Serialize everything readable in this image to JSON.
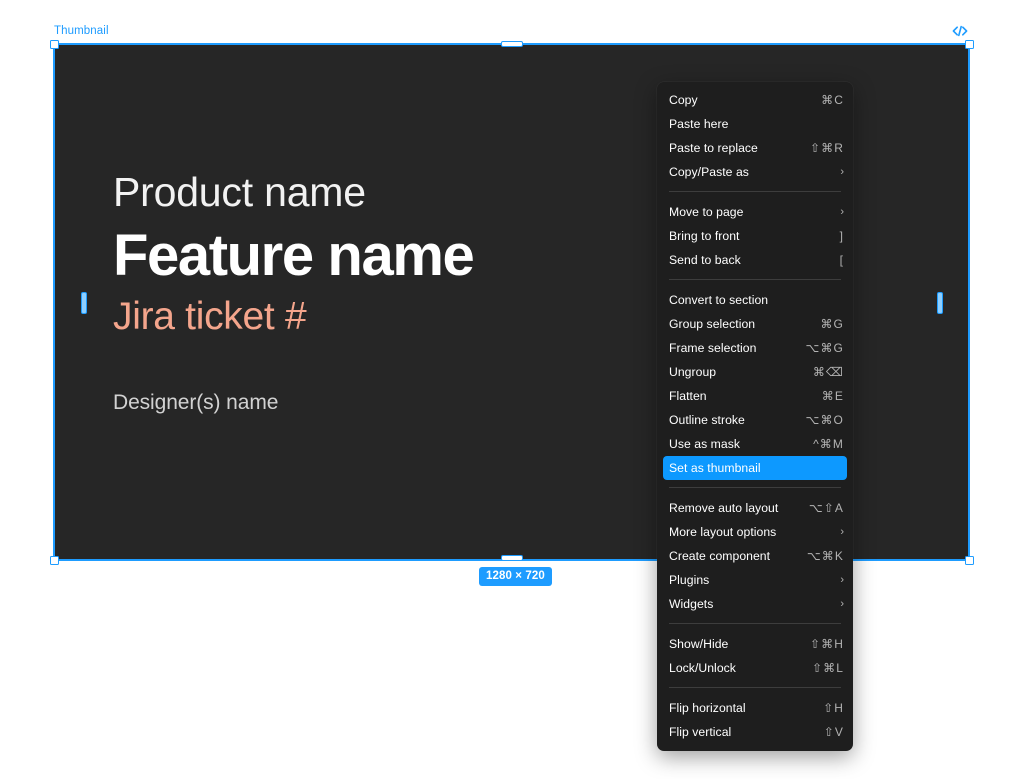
{
  "canvas": {
    "background_color": "#ffffff",
    "frame_label": "Thumbnail",
    "code_icon": "code-icon",
    "size_badge": "1280 × 720",
    "accent_color": "#1e9cff",
    "thumbnail": {
      "background_color": "#262626",
      "product_name": "Product name",
      "feature_name": "Feature name",
      "jira_ticket": "Jira ticket #",
      "jira_ticket_color": "#f4a58c",
      "designer_name": "Designer(s) name"
    }
  },
  "context_menu": {
    "highlight_color": "#0d99ff",
    "groups": [
      {
        "items": [
          {
            "label": "Copy",
            "shortcut": "⌘C",
            "arrow": "",
            "selected": false
          },
          {
            "label": "Paste here",
            "shortcut": "",
            "arrow": "",
            "selected": false
          },
          {
            "label": "Paste to replace",
            "shortcut": "⇧⌘R",
            "arrow": "",
            "selected": false
          },
          {
            "label": "Copy/Paste as",
            "shortcut": "",
            "arrow": "›",
            "selected": false
          }
        ]
      },
      {
        "items": [
          {
            "label": "Move to page",
            "shortcut": "",
            "arrow": "›",
            "selected": false
          },
          {
            "label": "Bring to front",
            "shortcut": "]",
            "arrow": "",
            "selected": false
          },
          {
            "label": "Send to back",
            "shortcut": "[",
            "arrow": "",
            "selected": false
          }
        ]
      },
      {
        "items": [
          {
            "label": "Convert to section",
            "shortcut": "",
            "arrow": "",
            "selected": false
          },
          {
            "label": "Group selection",
            "shortcut": "⌘G",
            "arrow": "",
            "selected": false
          },
          {
            "label": "Frame selection",
            "shortcut": "⌥⌘G",
            "arrow": "",
            "selected": false
          },
          {
            "label": "Ungroup",
            "shortcut": "⌘⌫",
            "arrow": "",
            "selected": false
          },
          {
            "label": "Flatten",
            "shortcut": "⌘E",
            "arrow": "",
            "selected": false
          },
          {
            "label": "Outline stroke",
            "shortcut": "⌥⌘O",
            "arrow": "",
            "selected": false
          },
          {
            "label": "Use as mask",
            "shortcut": "^⌘M",
            "arrow": "",
            "selected": false
          },
          {
            "label": "Set as thumbnail",
            "shortcut": "",
            "arrow": "",
            "selected": true
          }
        ]
      },
      {
        "items": [
          {
            "label": "Remove auto layout",
            "shortcut": "⌥⇧A",
            "arrow": "",
            "selected": false
          },
          {
            "label": "More layout options",
            "shortcut": "",
            "arrow": "›",
            "selected": false
          },
          {
            "label": "Create component",
            "shortcut": "⌥⌘K",
            "arrow": "",
            "selected": false
          },
          {
            "label": "Plugins",
            "shortcut": "",
            "arrow": "›",
            "selected": false
          },
          {
            "label": "Widgets",
            "shortcut": "",
            "arrow": "›",
            "selected": false
          }
        ]
      },
      {
        "items": [
          {
            "label": "Show/Hide",
            "shortcut": "⇧⌘H",
            "arrow": "",
            "selected": false
          },
          {
            "label": "Lock/Unlock",
            "shortcut": "⇧⌘L",
            "arrow": "",
            "selected": false
          }
        ]
      },
      {
        "items": [
          {
            "label": "Flip horizontal",
            "shortcut": "⇧H",
            "arrow": "",
            "selected": false
          },
          {
            "label": "Flip vertical",
            "shortcut": "⇧V",
            "arrow": "",
            "selected": false
          }
        ]
      }
    ]
  }
}
